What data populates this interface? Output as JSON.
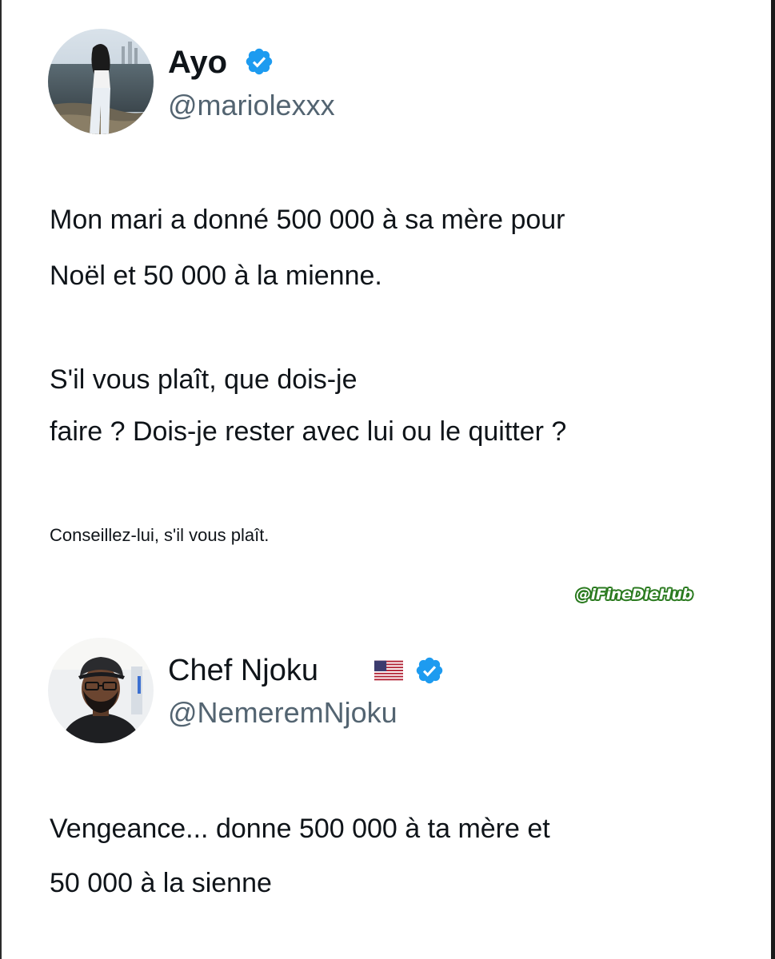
{
  "post_1": {
    "author": {
      "display_name": "Ayo",
      "handle": "@mariolexxx",
      "verified": true,
      "avatar_icon": "profile-photo-woman-by-sea"
    },
    "text": {
      "line_1": "Mon mari a donné 500 000 à sa mère pour",
      "line_2": "Noël et 50 000 à la mienne.",
      "line_3": "S'il vous plaît, que dois-je",
      "line_4": "faire ? Dois-je rester avec lui ou le quitter ?",
      "note": "Conseillez-lui, s'il vous plaît."
    }
  },
  "watermark": "@iFineDieHub",
  "post_2": {
    "author": {
      "display_name": "Chef Njoku",
      "handle": "@NemeremNjoku",
      "verified": true,
      "flag_icon": "us-flag-icon",
      "avatar_icon": "profile-photo-man-with-cap"
    },
    "text": {
      "line_1": "Vengeance... donne 500 000 à ta mère et",
      "line_2": "50 000 à la sienne"
    }
  },
  "colors": {
    "verified_blue": "#1d9bf0",
    "handle_gray": "#536471",
    "text": "#0f1419",
    "watermark_green": "#2a7a1f"
  }
}
